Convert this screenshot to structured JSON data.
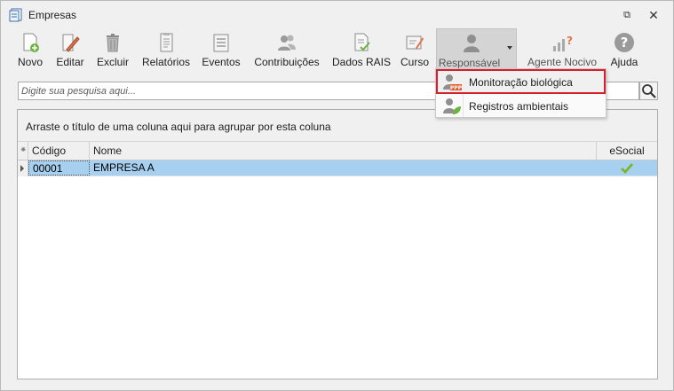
{
  "window": {
    "title": "Empresas",
    "icon": "document-app-icon",
    "controls": {
      "restore": "⧉",
      "close": "✕"
    }
  },
  "toolbar": {
    "items": [
      {
        "id": "novo",
        "label": "Novo",
        "icon": "new-document-icon"
      },
      {
        "id": "editar",
        "label": "Editar",
        "icon": "edit-pencil-icon"
      },
      {
        "id": "excluir",
        "label": "Excluir",
        "icon": "trash-icon"
      },
      {
        "id": "relatorios",
        "label": "Relatórios",
        "icon": "report-icon"
      },
      {
        "id": "eventos",
        "label": "Eventos",
        "icon": "list-icon"
      },
      {
        "id": "contribuicoes",
        "label": "Contribuições",
        "icon": "people-icon"
      },
      {
        "id": "dados_rais",
        "label": "Dados RAIS",
        "icon": "checked-document-icon"
      },
      {
        "id": "curso",
        "label": "Curso",
        "icon": "certificate-icon"
      },
      {
        "id": "responsavel",
        "label": "Responsável",
        "icon": "person-icon"
      },
      {
        "id": "agente_nocivo",
        "label": "Agente Nocivo",
        "icon": "bar-question-icon"
      },
      {
        "id": "ajuda",
        "label": "Ajuda",
        "icon": "help-icon"
      }
    ]
  },
  "search": {
    "placeholder": "Digite sua pesquisa aqui...",
    "value": ""
  },
  "grid": {
    "group_panel_text": "Arraste o título de uma coluna aqui para agrupar por esta coluna",
    "columns": {
      "indicator": "⁕",
      "codigo": "Código",
      "nome": "Nome",
      "esocial": "eSocial"
    },
    "rows": [
      {
        "codigo": "00001",
        "nome": "EMPRESA A",
        "esocial": "check"
      }
    ]
  },
  "dropdown": {
    "items": [
      {
        "label": "Monitoração biológica",
        "icon": "ppp-person-icon",
        "highlighted": true
      },
      {
        "label": "Registros ambientais",
        "icon": "person-leaf-icon",
        "highlighted": false
      }
    ]
  },
  "colors": {
    "selection": "#a6cff0",
    "highlight_border": "#d6202a",
    "esocial_check": "#7ab51d"
  }
}
